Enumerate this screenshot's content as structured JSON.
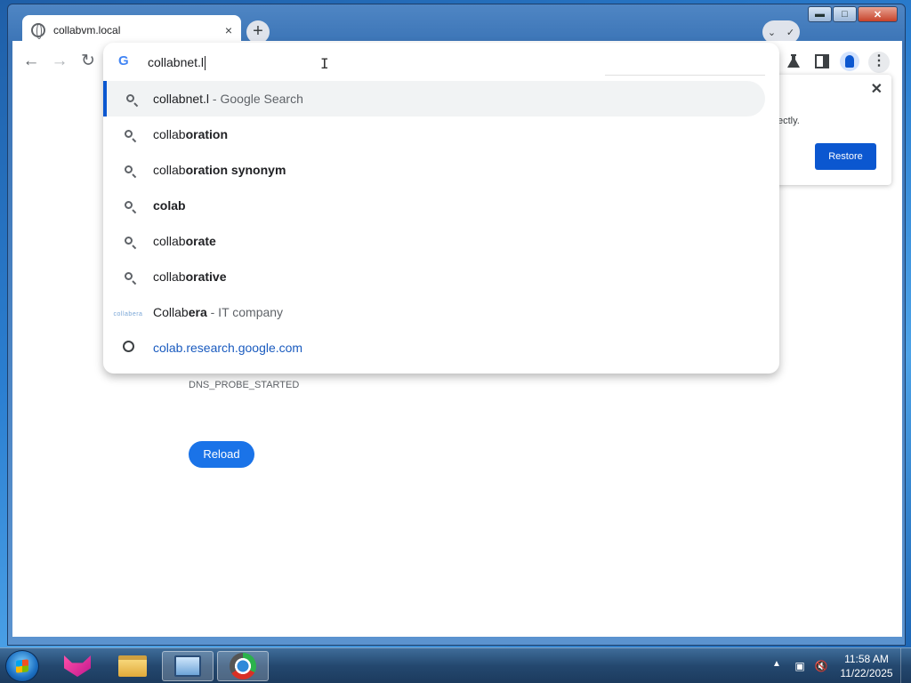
{
  "window": {
    "minimize": "▬",
    "maximize": "□",
    "close": "✕"
  },
  "tab": {
    "title": "collabvm.local",
    "close": "×",
    "icon": "globe-icon"
  },
  "newtab": "+",
  "tabsearch": {
    "down": "⌄",
    "check": "✓"
  },
  "toolbar": {
    "back": "←",
    "forward": "→",
    "reload": "↻",
    "menu": "⋮"
  },
  "omnibox": {
    "query": "collabnet.l",
    "suggestions": [
      {
        "prefix": "collabnet.l",
        "bold": "",
        "suffix": " - Google Search",
        "icon": "search-icon"
      },
      {
        "prefix": "collab",
        "bold": "oration",
        "suffix": "",
        "icon": "search-icon"
      },
      {
        "prefix": "collab",
        "bold": "oration synonym",
        "suffix": "",
        "icon": "search-icon"
      },
      {
        "prefix": "",
        "bold": "colab",
        "suffix": "",
        "icon": "search-icon"
      },
      {
        "prefix": "collab",
        "bold": "orate",
        "suffix": "",
        "icon": "search-icon"
      },
      {
        "prefix": "collab",
        "bold": "orative",
        "suffix": "",
        "icon": "search-icon"
      },
      {
        "prefix": "Collab",
        "bold": "era",
        "suffix": " - IT company",
        "icon": "collabera-logo-icon"
      },
      {
        "prefix": "",
        "bold": "",
        "suffix": "",
        "link": "colab.research.google.com",
        "icon": "globe-icon"
      }
    ]
  },
  "restore_bubble": {
    "text_fragment": "ectly.",
    "button": "Restore",
    "close": "✕"
  },
  "page": {
    "error_code": "DNS_PROBE_STARTED",
    "reload_button": "Reload"
  },
  "taskbar": {
    "time": "11:58 AM",
    "date": "11/22/2025",
    "tray_expand": "▲",
    "apps": [
      "fox-app-icon",
      "folder-icon",
      "monitor-icon",
      "chrome-icon"
    ]
  }
}
